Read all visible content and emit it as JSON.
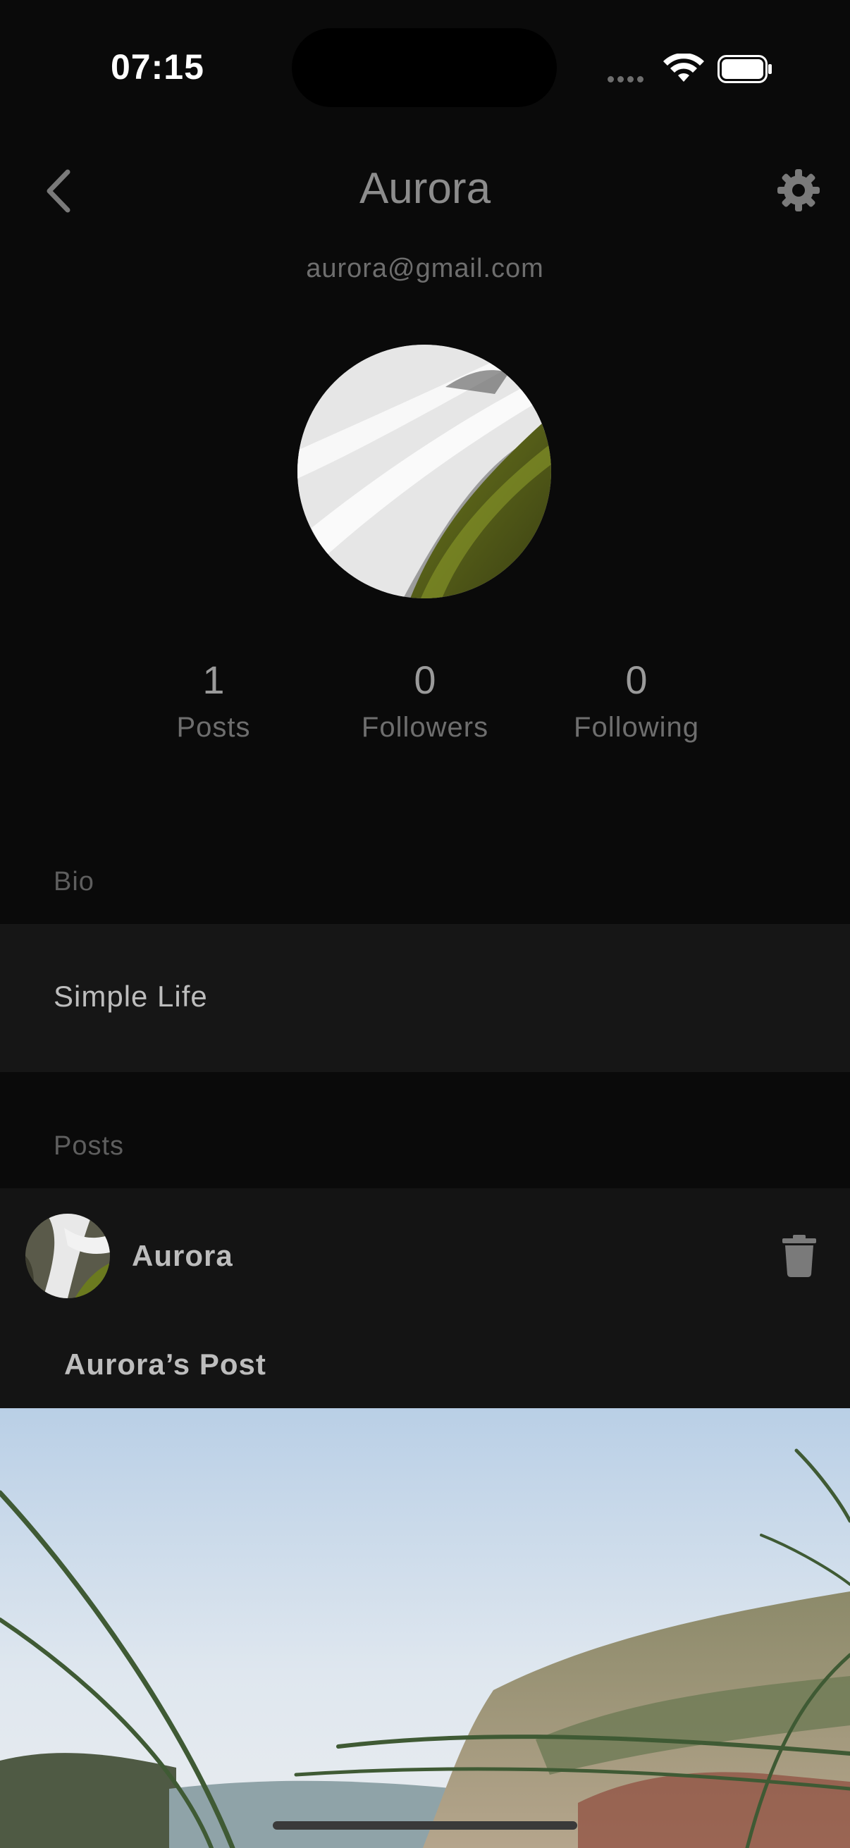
{
  "status_bar": {
    "time": "07:15"
  },
  "header": {
    "title": "Aurora",
    "email": "aurora@gmail.com"
  },
  "stats": [
    {
      "value": "1",
      "label": "Posts"
    },
    {
      "value": "0",
      "label": "Followers"
    },
    {
      "value": "0",
      "label": "Following"
    }
  ],
  "bio": {
    "section_label": "Bio",
    "text": "Simple Life"
  },
  "posts": {
    "section_label": "Posts",
    "items": [
      {
        "author": "Aurora",
        "title": "Aurora’s Post"
      }
    ]
  },
  "icons": {
    "back": "chevron-left-icon",
    "settings": "gear-icon",
    "delete": "trash-icon",
    "wifi": "wifi-icon",
    "battery": "battery-icon"
  },
  "colors": {
    "background": "#0a0a0a",
    "card": "#161616",
    "text_primary": "#bdbdbd",
    "text_secondary": "#6e6e6e"
  }
}
